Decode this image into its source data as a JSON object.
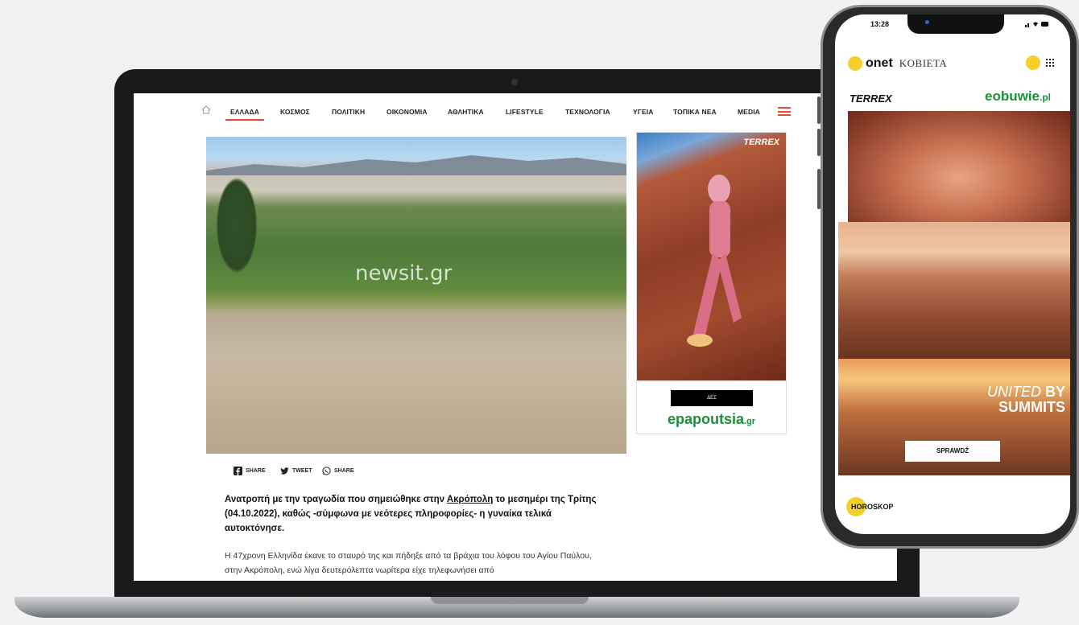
{
  "laptop": {
    "nav": {
      "items": [
        "ΕΛΛΑΔΑ",
        "ΚΟΣΜΟΣ",
        "ΠΟΛΙΤΙΚΗ",
        "ΟΙΚΟΝΟΜΙΑ",
        "ΑΘΛΗΤΙΚΑ",
        "LIFESTYLE",
        "ΤΕΧΝΟΛΟΓΙΑ",
        "ΥΓΕΙΑ",
        "ΤΟΠΙΚΑ ΝΕΑ",
        "MEDIA"
      ],
      "active": "ΕΛΛΑΔΑ"
    },
    "hero": {
      "watermark": "newsit.gr"
    },
    "ad": {
      "brand_top": "TERREX",
      "cta": "ΔΕΣ",
      "brand": "epapoutsia",
      "brand_suffix": ".gr"
    },
    "share": {
      "facebook": "SHARE",
      "twitter": "TWEET",
      "whatsapp": "SHARE"
    },
    "article": {
      "lead_before": "Ανατροπή με την τραγωδία που σημειώθηκε στην ",
      "lead_link": "Ακρόπολη",
      "lead_after": " το μεσημέρι της Τρίτης (04.10.2022), καθώς -σύμφωνα με νεότερες πληροφορίες- η γυναίκα τελικά αυτοκτόνησε.",
      "body": "Η 47χρονη Ελληνίδα έκανε το σταυρό της και πήδηξε από τα βράχια του λόφου του Αγίου Παύλου, στην Ακρόπολη, ενώ λίγα δευτερόλεπτα νωρίτερα είχε τηλεφωνήσει από"
    }
  },
  "phone": {
    "time": "13:28",
    "logo": "onet",
    "section": "KOBIETA",
    "ad": {
      "brand_left": "TERREX",
      "brand_right": "eobuwie",
      "brand_right_suffix": ".pl",
      "tagline_1": "UNITED",
      "tagline_2": "BY",
      "tagline_3": "SUMMITS",
      "cta": "SPRAWDŹ"
    },
    "section_label": "HOROSKOP"
  },
  "colors": {
    "accent": "#e84a2f",
    "onet_yellow": "#f6d02a",
    "green_brand": "#1d8f3b"
  }
}
